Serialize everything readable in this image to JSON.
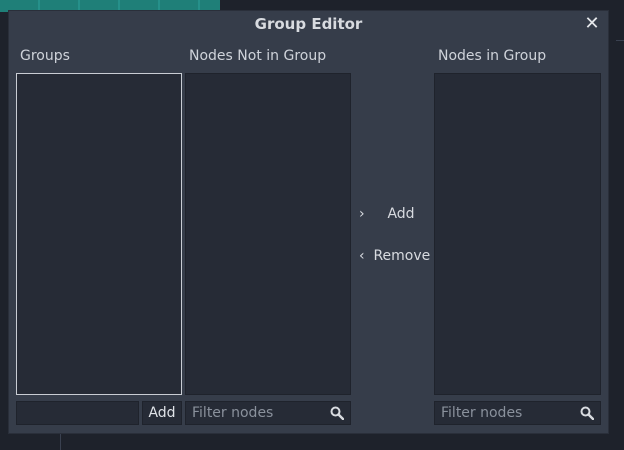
{
  "dialog": {
    "title": "Group Editor",
    "close_label": "✕"
  },
  "groups": {
    "label": "Groups",
    "name_input_value": "",
    "add_label": "Add"
  },
  "nodes_not_in_group": {
    "label": "Nodes Not in Group",
    "filter_placeholder": "Filter nodes"
  },
  "transfer": {
    "add_icon": "›",
    "add_label": "Add",
    "remove_icon": "‹",
    "remove_label": "Remove"
  },
  "nodes_in_group": {
    "label": "Nodes in Group",
    "filter_placeholder": "Filter nodes"
  },
  "icons": {
    "search": "search-icon"
  }
}
